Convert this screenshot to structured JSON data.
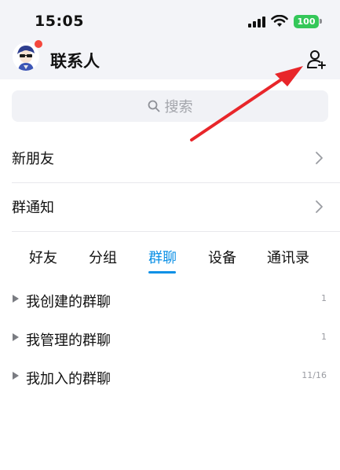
{
  "status_bar": {
    "time": "15:05",
    "battery": "100",
    "battery_color": "#34c759"
  },
  "header": {
    "title": "联系人",
    "avatar_badge_color": "#f5473c"
  },
  "search": {
    "placeholder": "搜索"
  },
  "rows": [
    {
      "label": "新朋友"
    },
    {
      "label": "群通知"
    }
  ],
  "tabs": [
    {
      "label": "好友",
      "active": false
    },
    {
      "label": "分组",
      "active": false
    },
    {
      "label": "群聊",
      "active": true
    },
    {
      "label": "设备",
      "active": false
    },
    {
      "label": "通讯录",
      "active": false
    }
  ],
  "groups": [
    {
      "label": "我创建的群聊",
      "count": "1"
    },
    {
      "label": "我管理的群聊",
      "count": "1"
    },
    {
      "label": "我加入的群聊",
      "count": "11/16"
    }
  ],
  "colors": {
    "accent": "#0b90e6",
    "annotation_arrow": "#e8262a"
  },
  "icons": {
    "add_friend": "person-add-icon",
    "search": "search-icon",
    "chevron": "chevron-right-icon",
    "caret": "caret-right-icon"
  }
}
